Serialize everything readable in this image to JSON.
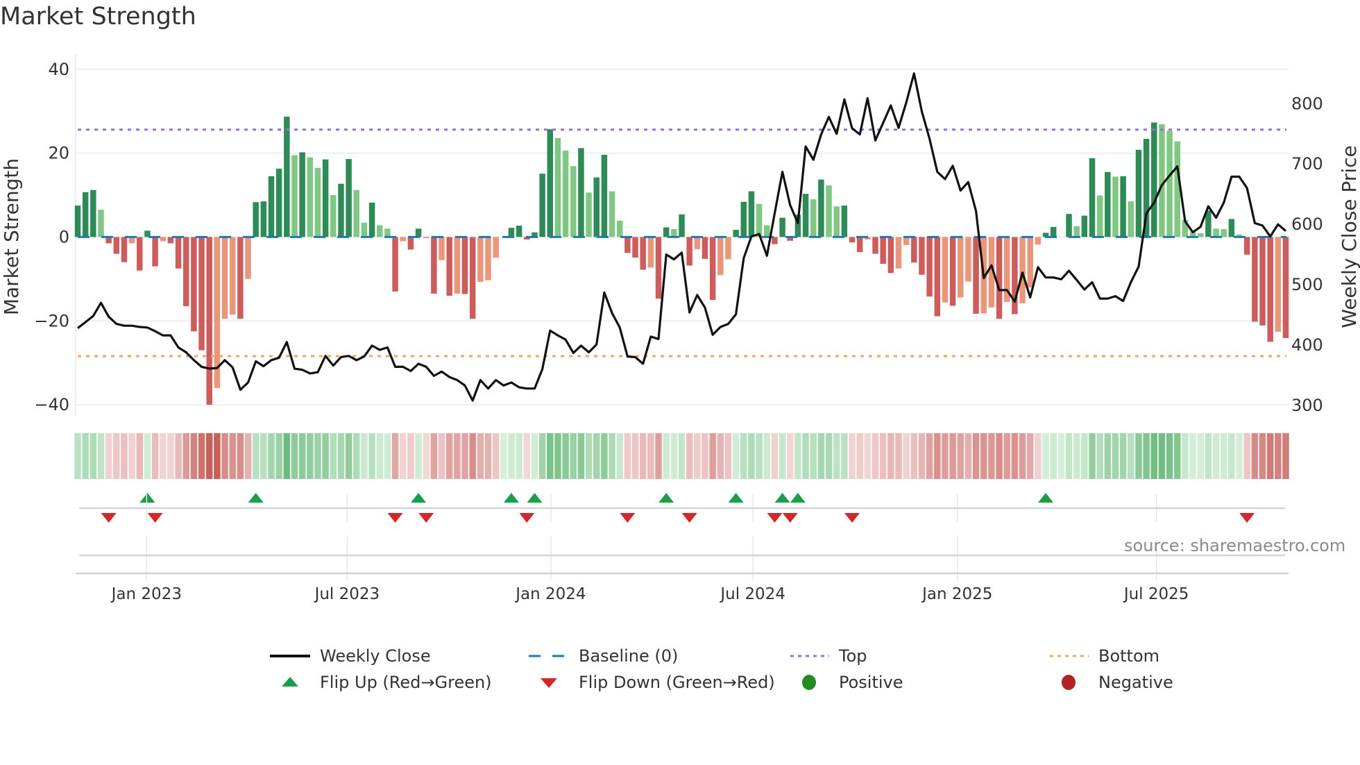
{
  "title": "Market Strength",
  "source": "source: sharemaestro.com",
  "colors": {
    "bar_up_strong": "#2e8b57",
    "bar_up_weak": "#81c784",
    "bar_down_strong": "#cd5c5c",
    "bar_down_weak": "#e9967a",
    "price_line": "#111111",
    "baseline": "#1f77b4",
    "top": "#9370db",
    "bottom": "#f4a460",
    "flip_up": "#1a9e4a",
    "flip_down": "#d62728",
    "positive": "#228b22",
    "negative": "#b22222",
    "strip_green_light": "#d6efd9",
    "strip_green_dark": "#62b576",
    "strip_red_light": "#f3d7d7",
    "strip_red_dark": "#c5605a",
    "grid": "#eceff1"
  },
  "chart_data": {
    "type": "bar+line",
    "title": "Market Strength",
    "ylabel": "Market Strength",
    "y2label": "Weekly Close Price",
    "ylim": [
      -42.8,
      43.6
    ],
    "y2lim": [
      281.6,
      882
    ],
    "grid": true,
    "legend_position": "bottom",
    "top_level": 25.6,
    "bottom_level": -28.4,
    "baseline": 0,
    "left_ticks": [
      {
        "value": 40,
        "label": "40"
      },
      {
        "value": 20,
        "label": "20"
      },
      {
        "value": 0,
        "label": "0"
      },
      {
        "value": -20,
        "label": "−20"
      },
      {
        "value": -40,
        "label": "−40"
      }
    ],
    "right_ticks": [
      {
        "value": 800,
        "label": "800"
      },
      {
        "value": 700,
        "label": "700"
      },
      {
        "value": 600,
        "label": "600"
      },
      {
        "value": 500,
        "label": "500"
      },
      {
        "value": 400,
        "label": "400"
      },
      {
        "value": 300,
        "label": "300"
      }
    ],
    "x_ticks": [
      {
        "week": 8.9,
        "label": "Jan 2023"
      },
      {
        "week": 34.8,
        "label": "Jul 2023"
      },
      {
        "week": 61.1,
        "label": "Jan 2024"
      },
      {
        "week": 87.2,
        "label": "Jul 2024"
      },
      {
        "week": 113.6,
        "label": "Jan 2025"
      },
      {
        "week": 139.3,
        "label": "Jul 2025"
      }
    ],
    "strength": [
      7.5,
      10.7,
      11.2,
      6.5,
      -1.5,
      -4,
      -6,
      -1.5,
      -8,
      1.5,
      -7,
      -1,
      -1.5,
      -7.5,
      -16.5,
      -22.5,
      -27,
      -40,
      -36,
      -19.5,
      -18.5,
      -19.5,
      -10,
      8.3,
      8.5,
      14.5,
      16.3,
      28.7,
      19.5,
      20.2,
      19,
      16.5,
      18.5,
      10,
      12.7,
      18.6,
      11.2,
      3.4,
      8.2,
      2.8,
      2,
      -13,
      -1,
      -3,
      2,
      -0.2,
      -13.5,
      -5.5,
      -14,
      -13.5,
      -13.6,
      -19.5,
      -10.7,
      -10.3,
      -4.9,
      0,
      2.2,
      2.7,
      -0.6,
      1.1,
      15.1,
      25.7,
      23.6,
      20.6,
      16.9,
      21.2,
      10.6,
      14.2,
      19.6,
      10.9,
      3.9,
      -3.8,
      -4.9,
      -7.8,
      -7.3,
      -14.7,
      2.3,
      1.9,
      5.4,
      -6.8,
      -2.9,
      -5.2,
      -15,
      -9.1,
      -5.3,
      1.7,
      8.4,
      10.9,
      7.9,
      2.8,
      -1.7,
      4.6,
      -0.9,
      5.3,
      10.3,
      9,
      13.7,
      12.3,
      7.3,
      7.5,
      -1.3,
      -3.6,
      -0.6,
      -4,
      -6.4,
      -8.6,
      -7.5,
      -1.9,
      -6.1,
      -9,
      -14.2,
      -18.9,
      -15.6,
      -16.4,
      -14.4,
      -10.6,
      -18.3,
      -18.2,
      -16.8,
      -19.5,
      -15.5,
      -18.4,
      -15.8,
      -12,
      -1.8,
      1,
      2.4,
      0,
      5.5,
      2.6,
      5.1,
      18.8,
      9.9,
      15.5,
      14.4,
      14.5,
      8.5,
      20.8,
      23.4,
      27.3,
      26.9,
      25.3,
      22.8,
      4.1,
      1.3,
      0.9,
      6.3,
      2,
      1.9,
      4.3,
      0.6,
      -4.2,
      -20.2,
      -21.1,
      -25,
      -22.6,
      -24.1
    ],
    "weekly_close": [
      428,
      438,
      448,
      470,
      447,
      435,
      432,
      432,
      430,
      429,
      423,
      416,
      416,
      396,
      388,
      375,
      364,
      361,
      362,
      375,
      363,
      326,
      338,
      373,
      365,
      375,
      379,
      405,
      361,
      359,
      353,
      355,
      382,
      366,
      380,
      382,
      375,
      381,
      399,
      392,
      396,
      364,
      364,
      357,
      369,
      364,
      349,
      356,
      347,
      342,
      333,
      308,
      342,
      328,
      342,
      333,
      338,
      330,
      328,
      328,
      360,
      424,
      416,
      409,
      387,
      399,
      388,
      401,
      487,
      453,
      429,
      381,
      380,
      369,
      414,
      410,
      550,
      542,
      553,
      454,
      483,
      462,
      417,
      430,
      435,
      451,
      544,
      580,
      584,
      548,
      618,
      687,
      632,
      602,
      729,
      707,
      749,
      778,
      750,
      807,
      759,
      749,
      809,
      739,
      768,
      797,
      760,
      802,
      850,
      787,
      742,
      687,
      675,
      697,
      656,
      670,
      622,
      511,
      532,
      491,
      491,
      472,
      520,
      479,
      529,
      512,
      512,
      509,
      523,
      508,
      492,
      504,
      477,
      477,
      481,
      473,
      504,
      530,
      618,
      636,
      665,
      681,
      696,
      605,
      587,
      596,
      630,
      611,
      636,
      679,
      679,
      660,
      602,
      598,
      580,
      600,
      589
    ],
    "flip_up_weeks": [
      9,
      23,
      44,
      56,
      59,
      76,
      85,
      91,
      93,
      125
    ],
    "flip_down_weeks": [
      4,
      10,
      41,
      45,
      58,
      71,
      79,
      90,
      92,
      100,
      151
    ]
  },
  "legend": {
    "weekly_close": "Weekly Close",
    "baseline": "Baseline (0)",
    "top": "Top",
    "bottom": "Bottom",
    "flip_up": "Flip Up (Red→Green)",
    "flip_down": "Flip Down (Green→Red)",
    "positive": "Positive",
    "negative": "Negative"
  }
}
